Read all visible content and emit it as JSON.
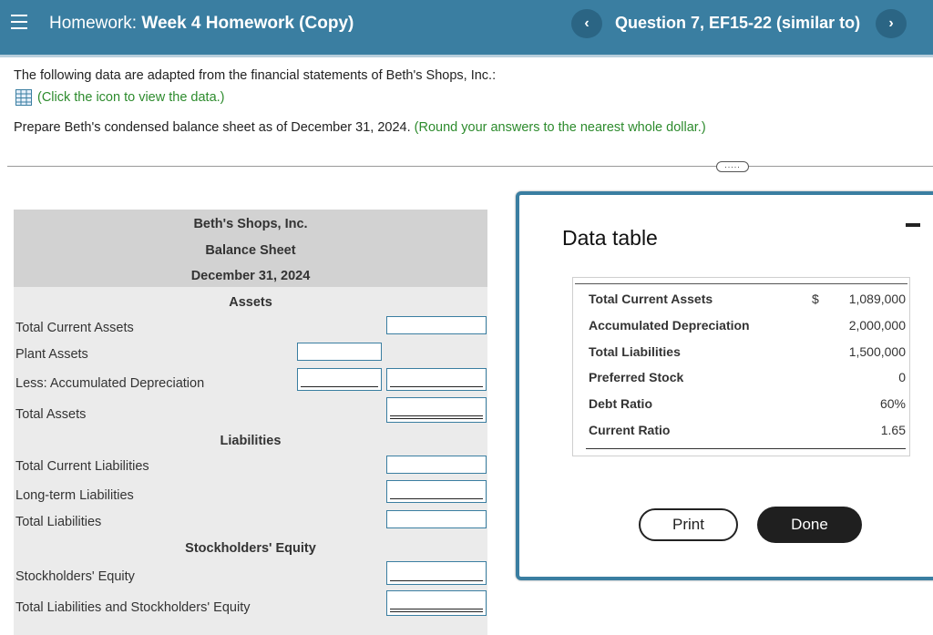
{
  "header": {
    "prefix": "Homework: ",
    "assignment": "Week 4 Homework (Copy)",
    "question": "Question 7, EF15-22 (similar to)",
    "prev_glyph": "‹",
    "next_glyph": "›"
  },
  "question": {
    "intro": "The following data are adapted from the financial statements of Beth's Shops, Inc.:",
    "data_link": "(Click the icon to view the data.)",
    "prepare": "Prepare Beth's condensed balance sheet as of December 31, 2024.",
    "hint": "(Round your answers to the nearest whole dollar.)",
    "more_glyph": "....."
  },
  "balance_sheet": {
    "company": "Beth's Shops, Inc.",
    "title": "Balance Sheet",
    "date": "December 31, 2024",
    "assets_heading": "Assets",
    "liabilities_heading": "Liabilities",
    "equity_heading": "Stockholders' Equity",
    "rows": {
      "total_current_assets": "Total Current Assets",
      "plant_assets": "Plant Assets",
      "less_acc_dep": "Less: Accumulated Depreciation",
      "total_assets": "Total Assets",
      "total_current_liabilities": "Total Current Liabilities",
      "long_term_liabilities": "Long-term Liabilities",
      "total_liabilities": "Total Liabilities",
      "stockholders_equity": "Stockholders' Equity",
      "total_liab_equity": "Total Liabilities and Stockholders' Equity"
    }
  },
  "data_table": {
    "title": "Data table",
    "rows": [
      {
        "label": "Total Current Assets",
        "symbol": "$",
        "value": "1,089,000"
      },
      {
        "label": "Accumulated Depreciation",
        "symbol": "",
        "value": "2,000,000"
      },
      {
        "label": "Total Liabilities",
        "symbol": "",
        "value": "1,500,000"
      },
      {
        "label": "Preferred Stock",
        "symbol": "",
        "value": "0"
      },
      {
        "label": "Debt Ratio",
        "symbol": "",
        "value": "60%"
      },
      {
        "label": "Current Ratio",
        "symbol": "",
        "value": "1.65"
      }
    ],
    "print_label": "Print",
    "done_label": "Done"
  },
  "colors": {
    "header_bg": "#3a7ea1",
    "hint_green": "#2d8b2d",
    "input_border": "#3a7ea1"
  }
}
